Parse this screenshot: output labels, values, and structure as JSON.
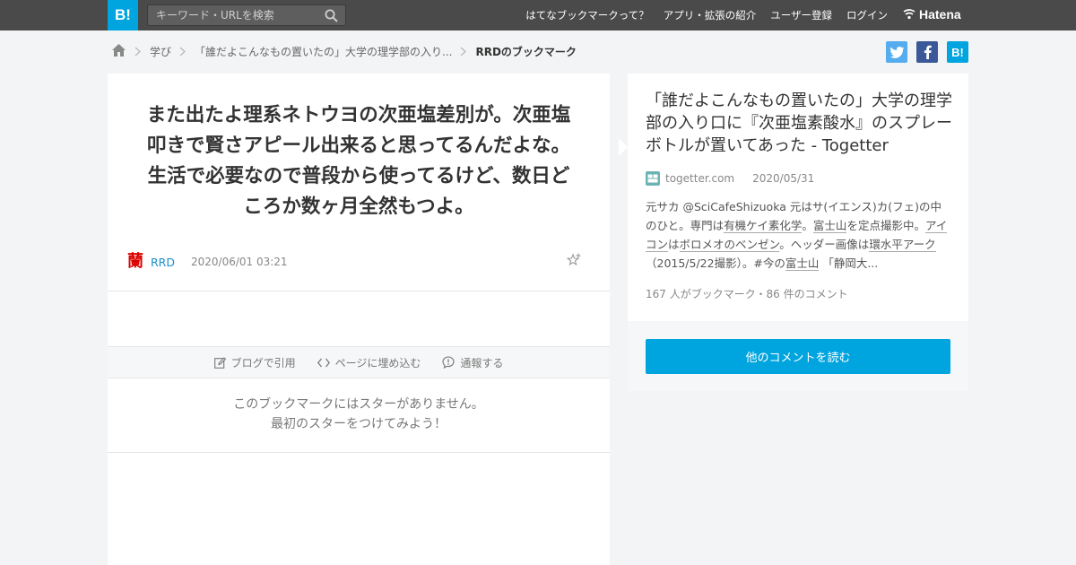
{
  "header": {
    "logo_text": "B!",
    "search_placeholder": "キーワード・URLを検索",
    "nav": [
      "はてなブックマークって？",
      "アプリ・拡張の紹介",
      "ユーザー登録",
      "ログイン"
    ],
    "brand": "Hatena"
  },
  "breadcrumb": {
    "items": [
      "学び",
      "「誰だよこんなもの置いたの」大学の理学部の入り..."
    ],
    "current": "RRDのブックマーク"
  },
  "social": {
    "hatena_label": "B!"
  },
  "bookmark": {
    "comment_lines": [
      "また出たよ理系ネトウヨの次亜塩差別が。次亜塩",
      "叩きで賢さアピール出来ると思ってるんだよな。",
      "生活で必要なので普段から使ってるけど、数日ど",
      "ころか数ヶ月全然もつよ。"
    ],
    "avatar_char": "蘭",
    "username": "RRD",
    "timestamp": "2020/06/01 03:21",
    "actions": [
      "ブログで引用",
      "ページに埋め込む",
      "通報する"
    ],
    "no_star_line1": "このブックマークにはスターがありません。",
    "no_star_line2": "最初のスターをつけてみよう！"
  },
  "entry": {
    "title": "「誰だよこんなもの置いたの」大学の理学部の入り口に『次亜塩素酸水』のスプレーボトルが置いてあった - Togetter",
    "domain": "togetter.com",
    "date": "2020/05/31",
    "desc": {
      "p1": "元サカ @SciCafeShizuoka 元はサ(イエンス)カ(フェ)の中のひと。専門は",
      "u1": "有機ケイ素化学",
      "p2": "。",
      "u2": "富士山",
      "p3": "を定点撮影中。",
      "u3": "アイコン",
      "p4": "は",
      "u4": "ボロメオのベンゼン",
      "p5": "。ヘッダー画像は",
      "u5": "環水平アーク",
      "p6": "（2015/5/22撮影）。#今の",
      "u6": "富士山",
      "p7": " 「静岡大..."
    },
    "count": "167 人がブックマーク・86 件のコメント",
    "read_button": "他のコメントを読む"
  }
}
